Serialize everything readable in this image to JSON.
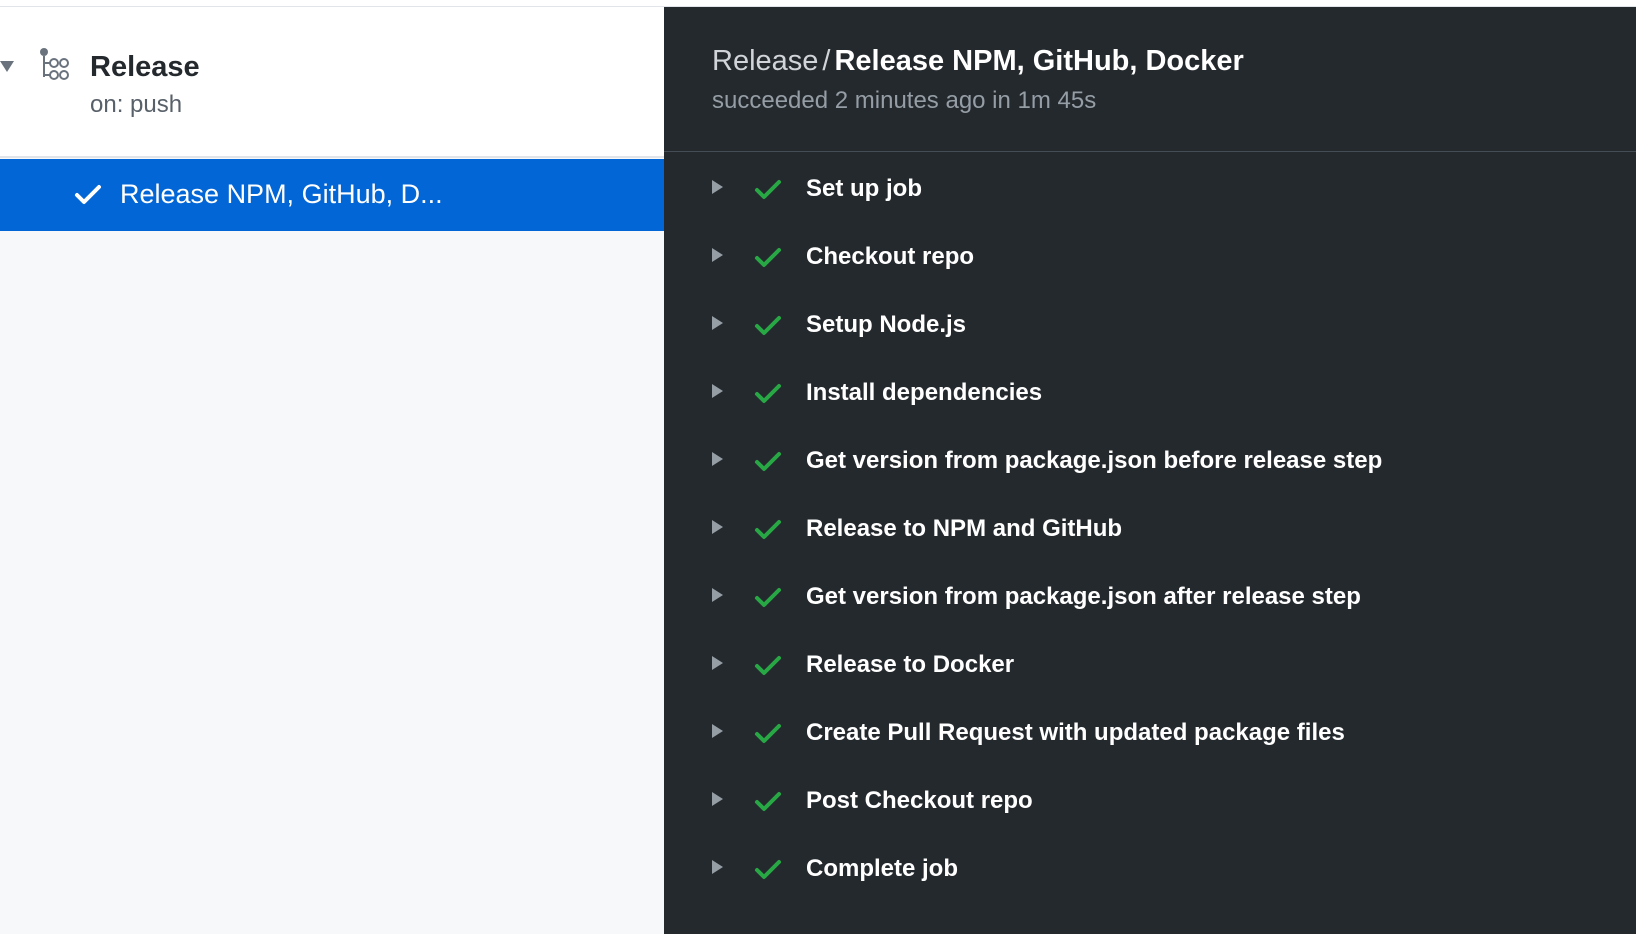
{
  "workflow": {
    "name": "Release",
    "trigger": "on: push",
    "icon": "workflow-icon"
  },
  "sidebar": {
    "jobs": [
      {
        "label": "Release NPM, GitHub, D...",
        "status": "success",
        "selected": true
      }
    ]
  },
  "run": {
    "breadcrumb_parent": "Release",
    "breadcrumb_separator": "/",
    "job_title": "Release NPM, GitHub, Docker",
    "status_text": "succeeded 2 minutes ago in 1m 45s"
  },
  "steps": [
    {
      "label": "Set up job",
      "status": "success"
    },
    {
      "label": "Checkout repo",
      "status": "success"
    },
    {
      "label": "Setup Node.js",
      "status": "success"
    },
    {
      "label": "Install dependencies",
      "status": "success"
    },
    {
      "label": "Get version from package.json before release step",
      "status": "success"
    },
    {
      "label": "Release to NPM and GitHub",
      "status": "success"
    },
    {
      "label": "Get version from package.json after release step",
      "status": "success"
    },
    {
      "label": "Release to Docker",
      "status": "success"
    },
    {
      "label": "Create Pull Request with updated package files",
      "status": "success"
    },
    {
      "label": "Post Checkout repo",
      "status": "success"
    },
    {
      "label": "Complete job",
      "status": "success"
    }
  ],
  "colors": {
    "accent": "#0366d6",
    "success": "#28a745",
    "dark_bg": "#24292e",
    "sidebar_bg": "#f6f8fa"
  }
}
